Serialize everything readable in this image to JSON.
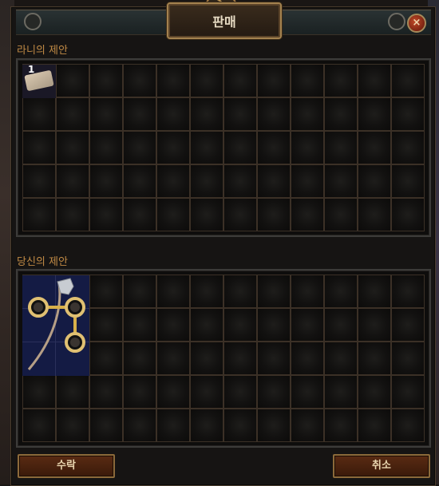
{
  "window": {
    "title": "판매",
    "close_icon": "close-icon"
  },
  "vendor_offer": {
    "label": "라니의 제안",
    "item": {
      "icon": "scroll-icon",
      "stack_count": "1"
    }
  },
  "your_offer": {
    "label": "당신의 제안",
    "item": {
      "icon": "axe-weapon-icon"
    }
  },
  "buttons": {
    "accept": "수락",
    "cancel": "취소"
  },
  "colors": {
    "label": "#c08a45",
    "button_bg": "#4a2310",
    "button_border": "#8c6a3a",
    "item_highlight": "#141b44"
  }
}
